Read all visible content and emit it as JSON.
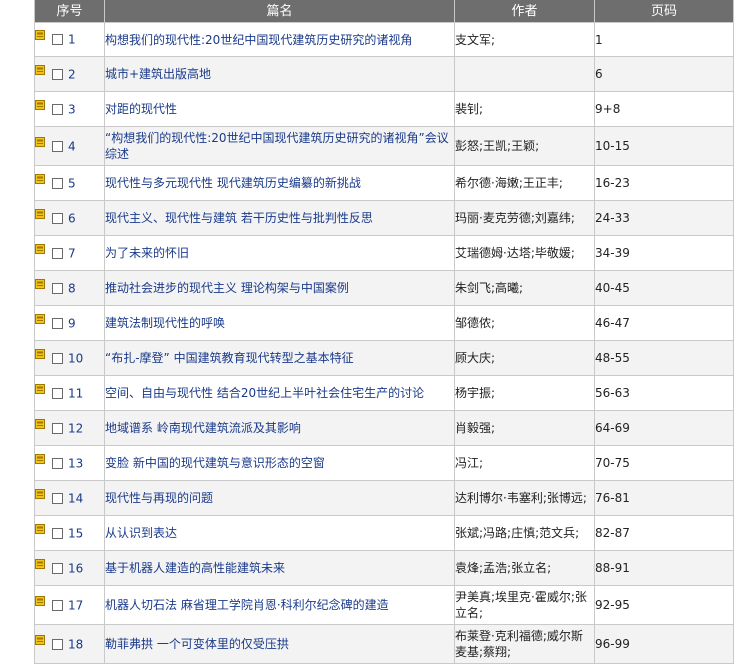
{
  "columns": {
    "index": "序号",
    "title": "篇名",
    "author": "作者",
    "pages": "页码"
  },
  "icons": {
    "favorite": "folder-icon",
    "select": "checkbox-icon"
  },
  "colors": {
    "header_bg": "#6e6e6e",
    "link": "#1a3a8a",
    "icon": "#e6b800"
  },
  "rows": [
    {
      "num": "1",
      "title": "构想我们的现代性:20世纪中国现代建筑历史研究的诸视角",
      "author": "支文军;",
      "pages": "1"
    },
    {
      "num": "2",
      "title": "城市+建筑出版高地",
      "author": "",
      "pages": "6"
    },
    {
      "num": "3",
      "title": "对距的现代性",
      "author": "裴钊;",
      "pages": "9+8"
    },
    {
      "num": "4",
      "title": "“构想我们的现代性:20世纪中国现代建筑历史研究的诸视角”会议综述",
      "author": "彭怒;王凯;王颖;",
      "pages": "10-15"
    },
    {
      "num": "5",
      "title": "现代性与多元现代性 现代建筑历史编纂的新挑战",
      "author": "希尔德·海嫩;王正丰;",
      "pages": "16-23"
    },
    {
      "num": "6",
      "title": "现代主义、现代性与建筑 若干历史性与批判性反思",
      "author": "玛丽·麦克劳德;刘嘉纬;",
      "pages": "24-33"
    },
    {
      "num": "7",
      "title": "为了未来的怀旧",
      "author": "艾瑞德姆·达塔;毕敬媛;",
      "pages": "34-39"
    },
    {
      "num": "8",
      "title": "推动社会进步的现代主义 理论构架与中国案例",
      "author": "朱剑飞;高曦;",
      "pages": "40-45"
    },
    {
      "num": "9",
      "title": "建筑法制现代性的呼唤",
      "author": "邹德侬;",
      "pages": "46-47"
    },
    {
      "num": "10",
      "title": "“布扎-摩登” 中国建筑教育现代转型之基本特征",
      "author": "顾大庆;",
      "pages": "48-55"
    },
    {
      "num": "11",
      "title": "空间、自由与现代性 结合20世纪上半叶社会住宅生产的讨论",
      "author": "杨宇振;",
      "pages": "56-63"
    },
    {
      "num": "12",
      "title": "地域谱系 岭南现代建筑流派及其影响",
      "author": "肖毅强;",
      "pages": "64-69"
    },
    {
      "num": "13",
      "title": "变脸 新中国的现代建筑与意识形态的空窗",
      "author": "冯江;",
      "pages": "70-75"
    },
    {
      "num": "14",
      "title": "现代性与再现的问题",
      "author": "达利博尔·韦塞利;张博远;",
      "pages": "76-81"
    },
    {
      "num": "15",
      "title": "从认识到表达",
      "author": "张斌;冯路;庄慎;范文兵;",
      "pages": "82-87"
    },
    {
      "num": "16",
      "title": "基于机器人建造的高性能建筑未来",
      "author": "袁烽;孟浩;张立名;",
      "pages": "88-91"
    },
    {
      "num": "17",
      "title": "机器人切石法 麻省理工学院肖恩·科利尔纪念碑的建造",
      "author": "尹美真;埃里克·霍威尔;张立名;",
      "pages": "92-95"
    },
    {
      "num": "18",
      "title": "勒菲弗拱 一个可变体里的仅受压拱",
      "author": "布莱登·克利福德;威尔斯 麦基;蔡翔;",
      "pages": "96-99"
    }
  ]
}
